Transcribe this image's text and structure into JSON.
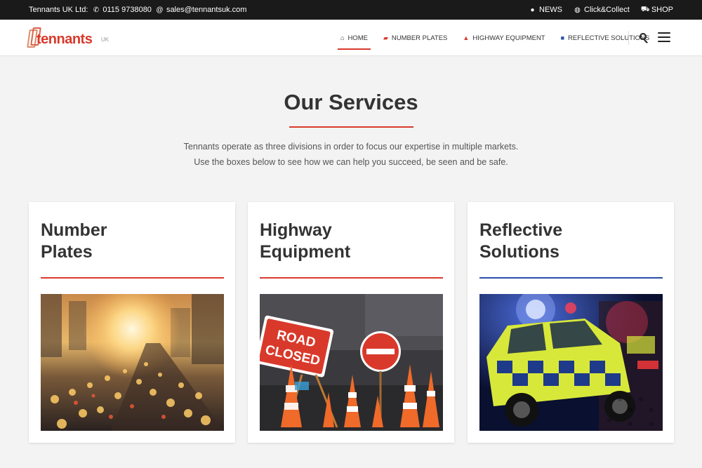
{
  "topbar": {
    "company": "Tennants UK Ltd:",
    "phone": "0115 9738080",
    "email": "sales@tennantsuk.com",
    "links": [
      {
        "label": "NEWS",
        "icon": "comments-icon"
      },
      {
        "label": "Click&Collect",
        "icon": "globe-icon"
      },
      {
        "label": "SHOP",
        "icon": "cart-icon"
      }
    ]
  },
  "logo": {
    "word": "tennants",
    "suffix": "UK"
  },
  "nav": [
    {
      "label": "HOME",
      "icon": "home-icon",
      "active": true
    },
    {
      "label": "NUMBER PLATES",
      "icon": "car-icon"
    },
    {
      "label": "HIGHWAY EQUIPMENT",
      "icon": "warning-icon"
    },
    {
      "label": "REFLECTIVE SOLUTIONS",
      "icon": "square-icon"
    }
  ],
  "main": {
    "title": "Our Services",
    "intro_line1": "Tennants operate as three divisions in order to focus our expertise in multiple markets.",
    "intro_line2": "Use the boxes below to see how we can help you succeed, be seen and be safe."
  },
  "cards": [
    {
      "title_line1": "Number",
      "title_line2": "Plates",
      "rule_color": "#d9392b"
    },
    {
      "title_line1": "Highway",
      "title_line2": "Equipment",
      "rule_color": "#d9392b"
    },
    {
      "title_line1": "Reflective",
      "title_line2": "Solutions",
      "rule_color": "#2a4fa8"
    }
  ],
  "sign_text": {
    "line1": "ROAD",
    "line2": "CLOSED"
  },
  "colors": {
    "accent": "#d9392b",
    "blue": "#2a4fa8",
    "topbar": "#1a1a1a"
  }
}
